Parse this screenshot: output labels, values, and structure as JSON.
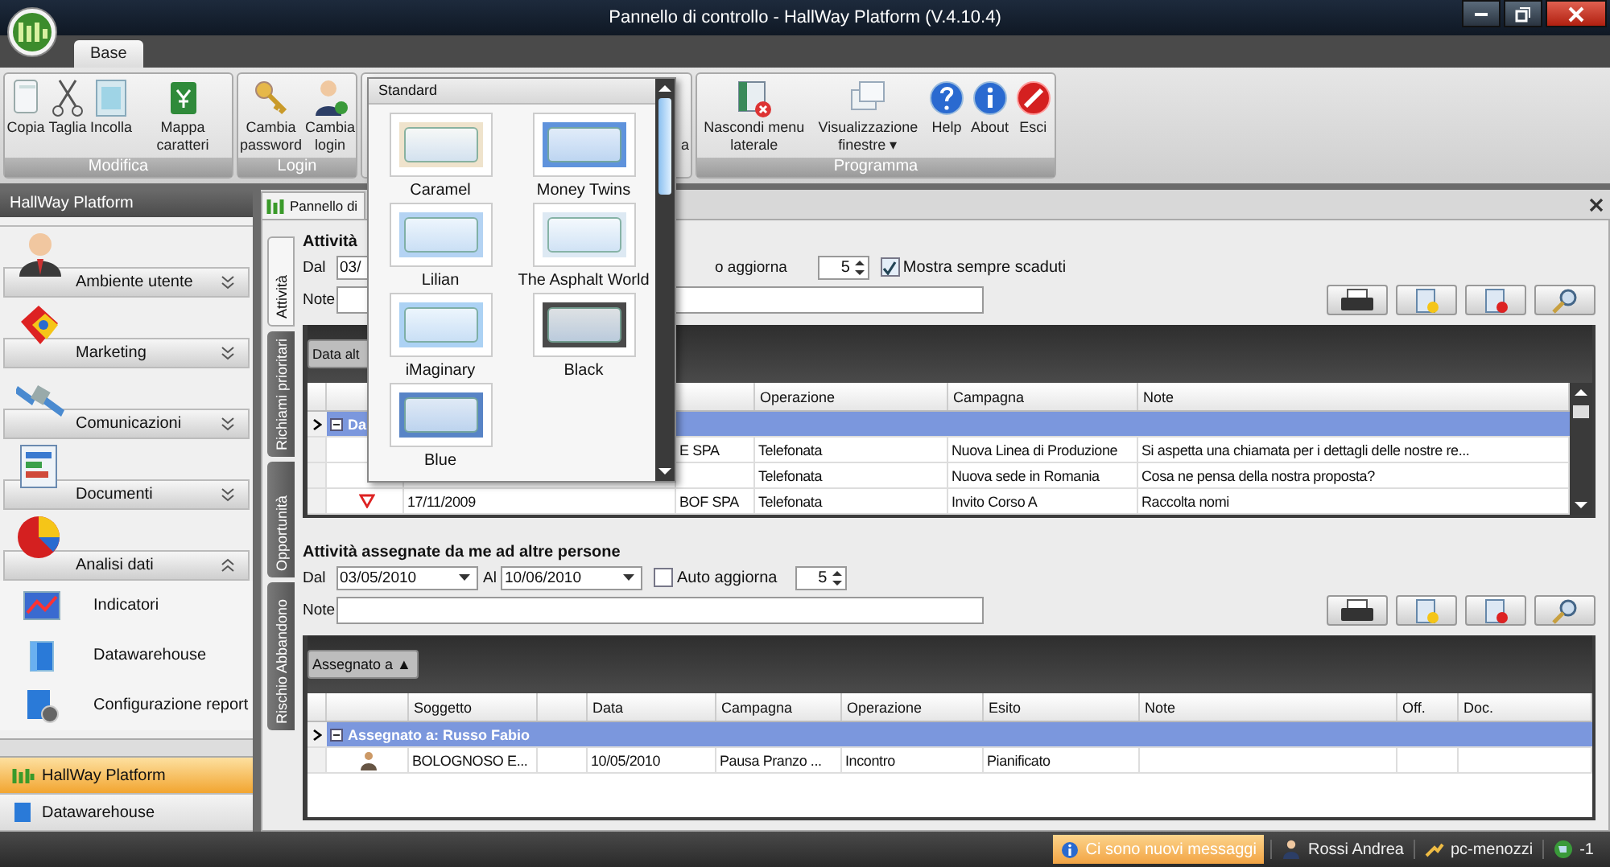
{
  "window": {
    "title": "Pannello di controllo - HallWay Platform (V.4.10.4)"
  },
  "ribbon": {
    "tabs": [
      {
        "label": "Base",
        "selected": true
      }
    ],
    "groups": [
      {
        "label": "Modifica",
        "buttons": [
          {
            "label": "Copia",
            "kind": "copy"
          },
          {
            "label": "Taglia",
            "kind": "cut"
          },
          {
            "label": "Incolla",
            "kind": "paste"
          },
          {
            "label": "Mappa caratteri",
            "kind": "charmap"
          }
        ]
      },
      {
        "label": "Login",
        "buttons": [
          {
            "label": "Cambia password",
            "kind": "keys"
          },
          {
            "label": "Cambia login",
            "kind": "person"
          }
        ]
      },
      {
        "buttons": [
          {
            "label": "a",
            "kind": "hidden"
          }
        ]
      },
      {
        "label": "Programma",
        "buttons": [
          {
            "label": "Nascondi menu laterale",
            "kind": "hide"
          },
          {
            "label": "Visualizzazione finestre ▾",
            "kind": "windows"
          },
          {
            "label": "Help",
            "kind": "help"
          },
          {
            "label": "About",
            "kind": "about"
          },
          {
            "label": "Esci",
            "kind": "exit"
          }
        ]
      }
    ]
  },
  "skin_gallery": {
    "header": "Standard",
    "skins": [
      {
        "name": "Caramel",
        "color": "#efe3cc"
      },
      {
        "name": "Money Twins",
        "color": "#5f93dc"
      },
      {
        "name": "Lilian",
        "color": "#b4d3f3"
      },
      {
        "name": "The Asphalt World",
        "color": "#dde9f3"
      },
      {
        "name": "iMaginary",
        "color": "#acd2f4"
      },
      {
        "name": "Black",
        "color": "#4a4a4a"
      },
      {
        "name": "Blue",
        "color": "#5884c6"
      }
    ]
  },
  "sidebar": {
    "header": "HallWay Platform",
    "groups": [
      {
        "label": "Ambiente utente",
        "kind": "user",
        "expanded": false
      },
      {
        "label": "Marketing",
        "kind": "marketing",
        "expanded": false
      },
      {
        "label": "Comunicazioni",
        "kind": "satellite",
        "expanded": false
      },
      {
        "label": "Documenti",
        "kind": "document",
        "expanded": false
      },
      {
        "label": "Analisi dati",
        "kind": "pie",
        "expanded": true,
        "items": [
          {
            "label": "Indicatori",
            "kind": "indicator"
          },
          {
            "label": "Datawarehouse",
            "kind": "cube"
          },
          {
            "label": "Configurazione report",
            "kind": "report"
          }
        ]
      }
    ],
    "nav": [
      {
        "label": "HallWay Platform",
        "kind": "logo",
        "selected": true
      },
      {
        "label": "Datawarehouse",
        "kind": "cube",
        "selected": false
      }
    ]
  },
  "document": {
    "tab": "Pannello di",
    "side_tabs": [
      {
        "label": "Attività",
        "selected": true
      },
      {
        "label": "Richiami prioritari",
        "selected": false
      },
      {
        "label": "Opportunità",
        "selected": false
      },
      {
        "label": "Rischio Abbandono",
        "selected": false
      }
    ],
    "sections": [
      {
        "title": "Attività",
        "from_label": "Dal",
        "from_value": "03/",
        "auto_label": "o aggiorna",
        "refresh": "5",
        "show_expired": {
          "label": "Mostra sempre scaduti",
          "checked": true
        },
        "note_label": "Note",
        "tools": [
          {
            "kind": "print"
          },
          {
            "kind": "new"
          },
          {
            "kind": "delete"
          },
          {
            "kind": "search"
          }
        ],
        "grid": {
          "group_panel": "Data alt",
          "columns": [
            {},
            {},
            {},
            {},
            {
              "label": "Operazione"
            },
            {
              "label": "Campagna"
            },
            {
              "label": "Note"
            }
          ],
          "group_row": "Da",
          "rows": [
            {
              "cells": [
                null,
                null,
                null,
                "E SPA",
                "Telefonata",
                "Nuova Linea di Produzione",
                "Si aspetta una chiamata per i dettagli delle nostre re..."
              ]
            },
            {
              "cells": [
                null,
                null,
                null,
                null,
                "Telefonata",
                "Nuova sede in Romania",
                "Cosa ne pensa della nostra proposta?"
              ]
            },
            {
              "kind": "alert",
              "cells": [
                null,
                null,
                "17/11/2009",
                "BOF SPA",
                "Telefonata",
                "Invito Corso A",
                "Raccolta nomi"
              ]
            }
          ]
        }
      },
      {
        "title": "Attività assegnate da me ad altre persone",
        "from_label": "Dal",
        "from_value": "03/05/2010",
        "to_label": "Al",
        "to_value": "10/06/2010",
        "auto": {
          "label": "Auto aggiorna",
          "checked": false
        },
        "refresh": "5",
        "note_label": "Note",
        "tools": [
          {
            "kind": "print"
          },
          {
            "kind": "new"
          },
          {
            "kind": "delete"
          },
          {
            "kind": "search"
          }
        ],
        "grid": {
          "group_panel": "Assegnato a ▲",
          "columns": [
            {},
            {},
            {
              "label": "Soggetto"
            },
            {},
            {
              "label": "Data"
            },
            {
              "label": "Campagna"
            },
            {
              "label": "Operazione"
            },
            {
              "label": "Esito"
            },
            {
              "label": "Note"
            },
            {
              "label": "Off."
            },
            {
              "label": "Doc."
            }
          ],
          "group_row": "Assegnato a: Russo Fabio",
          "rows": [
            {
              "kind": "person",
              "cells": [
                null,
                null,
                "BOLOGNOSO E...",
                null,
                "10/05/2010",
                "Pausa Pranzo ...",
                "Incontro",
                "Pianificato",
                null,
                null,
                null
              ]
            }
          ]
        }
      }
    ]
  },
  "status_bar": {
    "message": "Ci sono nuovi messaggi",
    "user": "Rossi Andrea",
    "computer": "pc-menozzi",
    "connection": "-1"
  }
}
